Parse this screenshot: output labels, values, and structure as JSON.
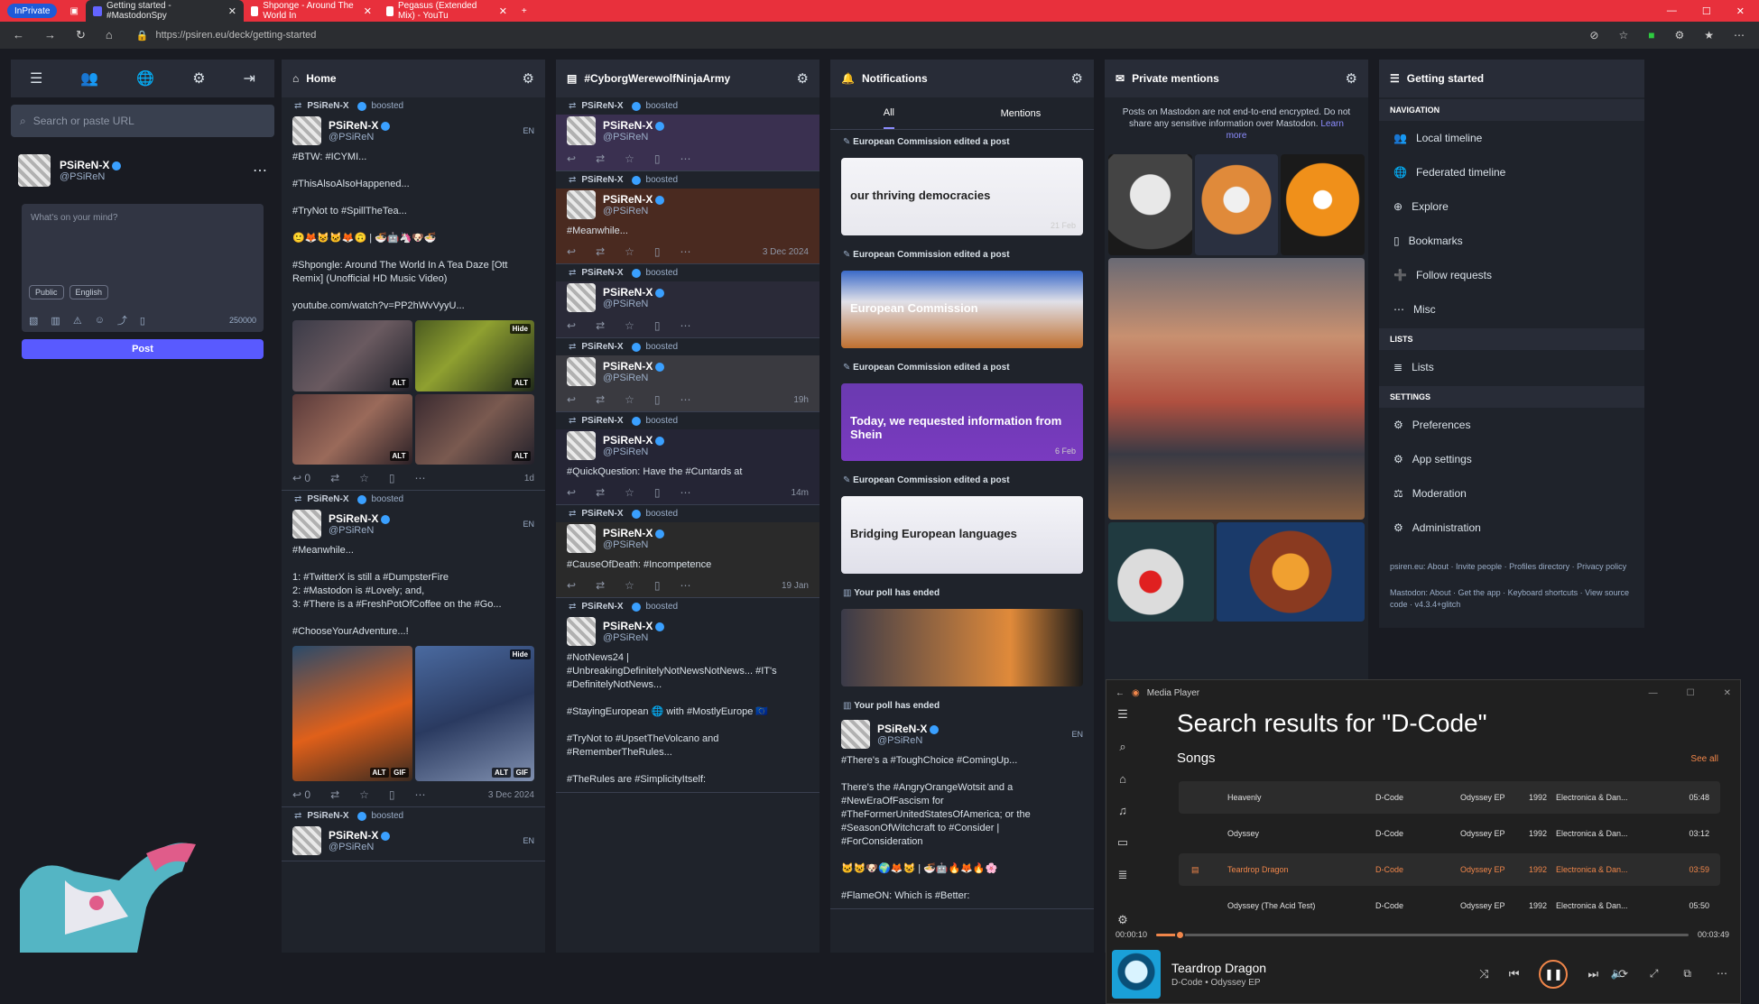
{
  "browser": {
    "inprivate": "InPrivate",
    "tabs": [
      {
        "title": "Getting started - #MastodonSpy",
        "color": "#6364ff"
      },
      {
        "title": "Shponge - Around The World In",
        "color": "#ff0000"
      },
      {
        "title": "Pegasus (Extended Mix) - YouTu",
        "color": "#ff0000"
      }
    ],
    "url": "https://psiren.eu/deck/getting-started",
    "accent": "#e8303c"
  },
  "drawer": {
    "search_placeholder": "Search or paste URL",
    "account": {
      "name": "PSiReN-X",
      "handle": "@PSiReN"
    },
    "compose": {
      "placeholder": "What's on your mind?",
      "privacy": "Public",
      "language": "English",
      "char_count": "250000",
      "post_label": "Post"
    }
  },
  "home": {
    "title": "Home",
    "statuses": [
      {
        "boosted_by": "PSiReN-X",
        "boost_label": "boosted",
        "name": "PSiReN-X",
        "handle": "@PSiReN",
        "meta": "EN",
        "text": "#BTW: #ICYMI...\n\n#ThisAlsoAlsoHappened...\n\n#TryNot to #SpillTheTea...\n\n🙂🦊😺🐱🦊🙃 | 🍜🤖🦄🐶🍜\n\n#Shpongle: Around The World In A Tea Daze [Ott Remix] (Unofficial HD Music Video)\n\nyoutube.com/watch?v=PP2hWvVyyU...",
        "media_labels": [
          "Hide",
          "ALT",
          "ALT",
          "ALT",
          "ALT"
        ],
        "date": "1d",
        "replies": "0"
      },
      {
        "boosted_by": "PSiReN-X",
        "boost_label": "boosted",
        "name": "PSiReN-X",
        "handle": "@PSiReN",
        "meta": "EN",
        "text": "#Meanwhile...\n\n1: #TwitterX is still a #DumpsterFire\n2: #Mastodon is #Lovely; and,\n3: #There is a #FreshPotOfCoffee on the #Go...\n\n#ChooseYourAdventure...!",
        "media_labels": [
          "Hide",
          "ALT",
          "GIF",
          "ALT",
          "GIF"
        ],
        "date": "3 Dec 2024",
        "replies": "0"
      },
      {
        "boosted_by": "PSiReN-X",
        "boost_label": "boosted",
        "name": "PSiReN-X",
        "handle": "@PSiReN",
        "meta": "EN"
      }
    ]
  },
  "hashtag": {
    "title": "#CyborgWerewolfNinjaArmy",
    "statuses": [
      {
        "boost_label": "boosted",
        "name": "PSiReN-X",
        "handle": "@PSiReN",
        "date": ""
      },
      {
        "boost_label": "boosted",
        "name": "PSiReN-X",
        "handle": "@PSiReN",
        "date": "3 Dec 2024",
        "text": "#Meanwhile..."
      },
      {
        "boost_label": "boosted",
        "name": "PSiReN-X",
        "handle": "@PSiReN",
        "date": ""
      },
      {
        "boost_label": "boosted",
        "name": "PSiReN-X",
        "handle": "@PSiReN",
        "date": "19h"
      },
      {
        "boost_label": "boosted",
        "name": "PSiReN-X",
        "handle": "@PSiReN",
        "date": "14m",
        "text": "#QuickQuestion: Have the #Cuntards at"
      },
      {
        "boost_label": "boosted",
        "name": "PSiReN-X",
        "handle": "@PSiReN",
        "date": "19 Jan",
        "text": "#CauseOfDeath: #Incompetence"
      },
      {
        "boost_label": "boosted",
        "name": "PSiReN-X",
        "handle": "@PSiReN",
        "date": "",
        "text": "#NotNews24 | #UnbreakingDefinitelyNotNewsNotNews... #IT's #DefinitelyNotNews...\n\n#StayingEuropean 🌐 with #MostlyEurope 🇪🇺\n\n#TryNot to #UpsetTheVolcano and #RememberTheRules...\n\n#TheRules are #SimplicityItself:"
      }
    ],
    "boosted_by": "PSiReN-X"
  },
  "notifications": {
    "title": "Notifications",
    "tabs": [
      "All",
      "Mentions"
    ],
    "items": [
      {
        "label": "European Commission edited a post",
        "caption": "our thriving democracies",
        "date": "21 Feb"
      },
      {
        "label": "European Commission edited a post",
        "caption": "European Commission",
        "date": ""
      },
      {
        "label": "European Commission edited a post",
        "caption": "Today, we requested information from Shein",
        "date": "6 Feb"
      },
      {
        "label": "European Commission edited a post",
        "caption": "Bridging European languages",
        "date": ""
      },
      {
        "label": "Your poll has ended",
        "caption": "",
        "date": ""
      },
      {
        "label": "Your poll has ended",
        "caption": "",
        "date": ""
      }
    ],
    "poll_status": {
      "name": "PSiReN-X",
      "handle": "@PSiReN",
      "meta": "EN",
      "text": "#There's a #ToughChoice #ComingUp...\n\nThere's the #AngryOrangeWotsit and a #NewEraOfFascism for #TheFormerUnitedStatesOfAmerica; or the #SeasonOfWitchcraft to #Consider | #ForConsideration\n\n🐱😺🐶🌍🦊😺 | 🍜🤖🔥🦊🔥🌸\n\n#FlameON: Which is #Better:"
    }
  },
  "private_mentions": {
    "title": "Private mentions",
    "info": "Posts on Mastodon are not end-to-end encrypted. Do not share any sensitive information over Mastodon.",
    "learn_more": "Learn more"
  },
  "getting_started": {
    "title": "Getting started",
    "sections": [
      {
        "label": "NAVIGATION",
        "items": [
          "Local timeline",
          "Federated timeline",
          "Explore",
          "Bookmarks",
          "Follow requests",
          "Misc"
        ]
      },
      {
        "label": "LISTS",
        "items": [
          "Lists"
        ]
      },
      {
        "label": "SETTINGS",
        "items": [
          "Preferences",
          "App settings",
          "Moderation",
          "Administration"
        ]
      }
    ],
    "footer1": "psiren.eu: About · Invite people · Profiles directory · Privacy policy",
    "footer2": "Mastodon: About · Get the app · Keyboard shortcuts · View source code · v4.3.4+glitch"
  },
  "media_player": {
    "app_title": "Media Player",
    "heading": "Search results for \"D-Code\"",
    "section": "Songs",
    "see_all": "See all",
    "songs": [
      {
        "title": "Heavenly",
        "artist": "D-Code",
        "album": "Odyssey EP",
        "year": "1992",
        "genre": "Electronica & Dan...",
        "length": "05:48"
      },
      {
        "title": "Odyssey",
        "artist": "D-Code",
        "album": "Odyssey EP",
        "year": "1992",
        "genre": "Electronica & Dan...",
        "length": "03:12"
      },
      {
        "title": "Teardrop Dragon",
        "artist": "D-Code",
        "album": "Odyssey EP",
        "year": "1992",
        "genre": "Electronica & Dan...",
        "length": "03:59"
      },
      {
        "title": "Odyssey (The Acid Test)",
        "artist": "D-Code",
        "album": "Odyssey EP",
        "year": "1992",
        "genre": "Electronica & Dan...",
        "length": "05:50"
      }
    ],
    "playing_index": 2,
    "elapsed": "00:00:10",
    "total": "00:03:49",
    "progress": 0.044,
    "now_playing": {
      "title": "Teardrop Dragon",
      "subtitle": "D-Code • Odyssey EP"
    },
    "accent": "#f0864a"
  }
}
